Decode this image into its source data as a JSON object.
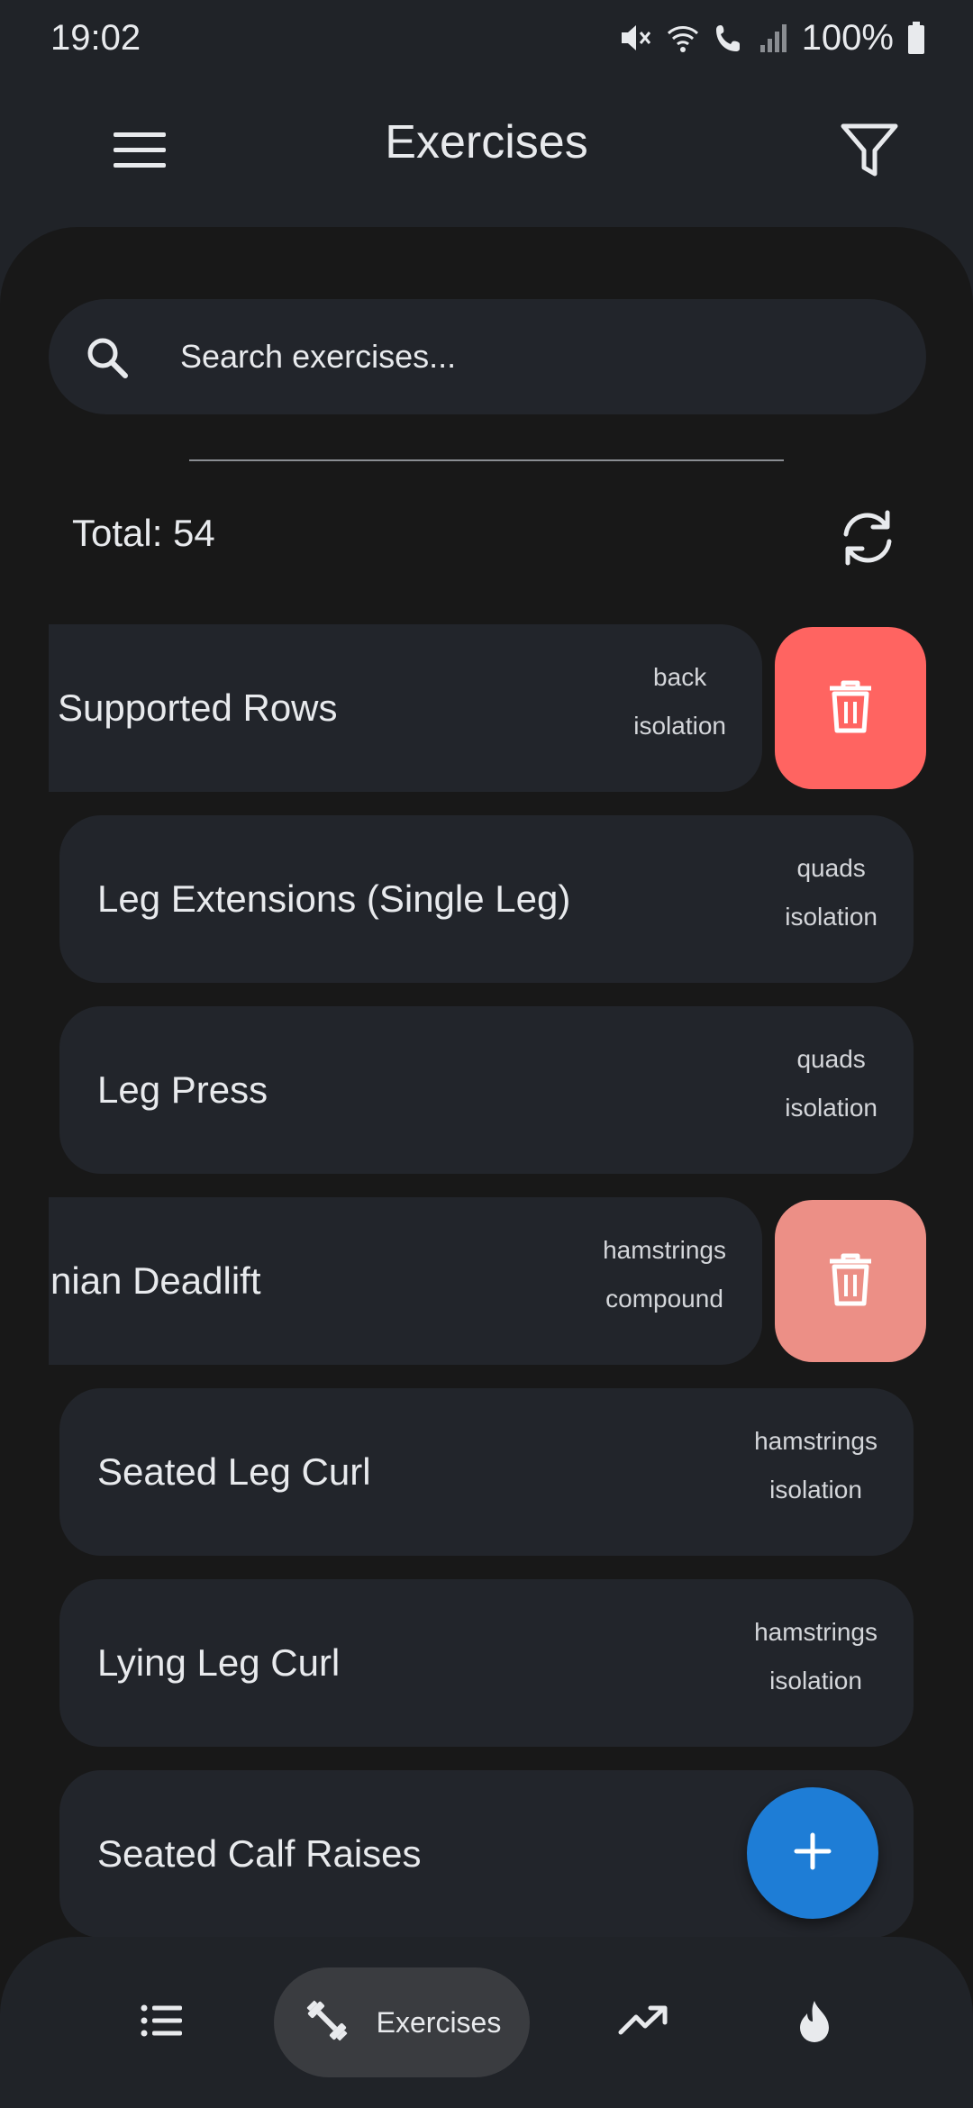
{
  "status_bar": {
    "time": "19:02",
    "battery": "100%",
    "icons": [
      "mute-icon",
      "wifi-icon",
      "wifi-calling-icon",
      "signal-icon",
      "battery-icon"
    ]
  },
  "app_bar": {
    "title": "Exercises",
    "left_icon": "menu-icon",
    "right_icon": "filter-icon"
  },
  "search": {
    "placeholder": "Search exercises..."
  },
  "summary": {
    "total": "Total: 54"
  },
  "exercises": [
    {
      "name": "Supported Rows",
      "muscle": "back",
      "type": "isolation",
      "swiped": true
    },
    {
      "name": "Leg Extensions (Single Leg)",
      "muscle": "quads",
      "type": "isolation",
      "swiped": false
    },
    {
      "name": "Leg Press",
      "muscle": "quads",
      "type": "isolation",
      "swiped": false
    },
    {
      "name": "nian Deadlift",
      "muscle": "hamstrings",
      "type": "compound",
      "swiped": true
    },
    {
      "name": "Seated Leg Curl",
      "muscle": "hamstrings",
      "type": "isolation",
      "swiped": false
    },
    {
      "name": "Lying Leg Curl",
      "muscle": "hamstrings",
      "type": "isolation",
      "swiped": false
    },
    {
      "name": "Seated Calf Raises",
      "muscle": "",
      "type": "",
      "swiped": false
    }
  ],
  "bottom_nav": {
    "items": [
      {
        "icon": "list-icon",
        "label": ""
      },
      {
        "icon": "dumbbell-icon",
        "label": "Exercises",
        "active": true
      },
      {
        "icon": "trending-up-icon",
        "label": ""
      },
      {
        "icon": "flame-icon",
        "label": ""
      }
    ]
  },
  "colors": {
    "background": "#202328",
    "sheet": "#181818",
    "card": "#22252b",
    "delete_primary": "#ff6461",
    "delete_faded": "#ec8f86",
    "fab": "#1e7dd6",
    "nav_active": "#3a3c40"
  }
}
